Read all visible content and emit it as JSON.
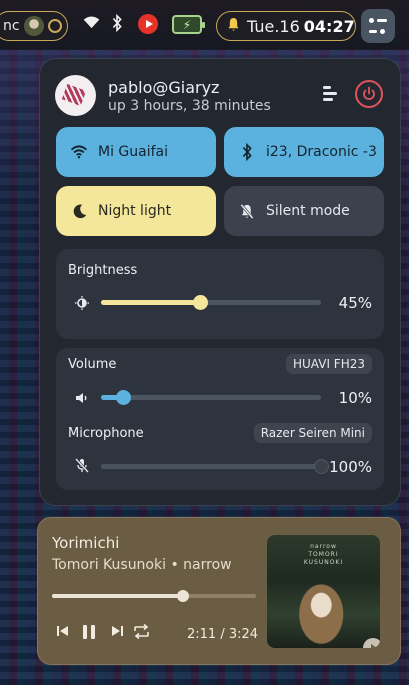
{
  "topbar": {
    "media_pill_text": "nc",
    "clock_date": "Tue.16",
    "clock_time": "04:27",
    "icons": [
      "media-thumb-icon",
      "wifi-icon",
      "bluetooth-icon",
      "youtube-music-icon",
      "battery-charging-icon",
      "bell-icon",
      "quick-settings-icon"
    ],
    "battery_glyph": "⚡"
  },
  "user": {
    "name": "pablo@Giaryz",
    "uptime": "up 3 hours, 38 minutes"
  },
  "tiles": {
    "wifi": {
      "label": "Mi Guaifai",
      "active": true
    },
    "bluetooth": {
      "label": "i23, Draconic -3",
      "active": true
    },
    "night_light": {
      "label": "Night light",
      "active": true
    },
    "silent_mode": {
      "label": "Silent mode",
      "active": false
    }
  },
  "brightness": {
    "label": "Brightness",
    "percent_text": "45%",
    "value": 0.45
  },
  "volume": {
    "label": "Volume",
    "device": "HUAVI FH23",
    "percent_text": "10%",
    "value": 0.1
  },
  "microphone": {
    "label": "Microphone",
    "device": "Razer Seiren Mini",
    "percent_text": "100%",
    "value": 1.0,
    "muted": true
  },
  "player": {
    "title": "Yorimichi",
    "artist_album": "Tomori Kusunoki • narrow",
    "time": "2:11 / 3:24",
    "progress": 0.64,
    "cover_text_1": "narrow",
    "cover_text_2": "TOMORI",
    "cover_text_3": "KUSUNOKI"
  },
  "colors": {
    "accent_blue": "#5cb2de",
    "accent_yellow": "#f4e69a",
    "brightness_fill": "#f4e69a",
    "volume_fill": "#5cb2de",
    "power": "#e0525c",
    "border_gold": "#c9a95a"
  }
}
